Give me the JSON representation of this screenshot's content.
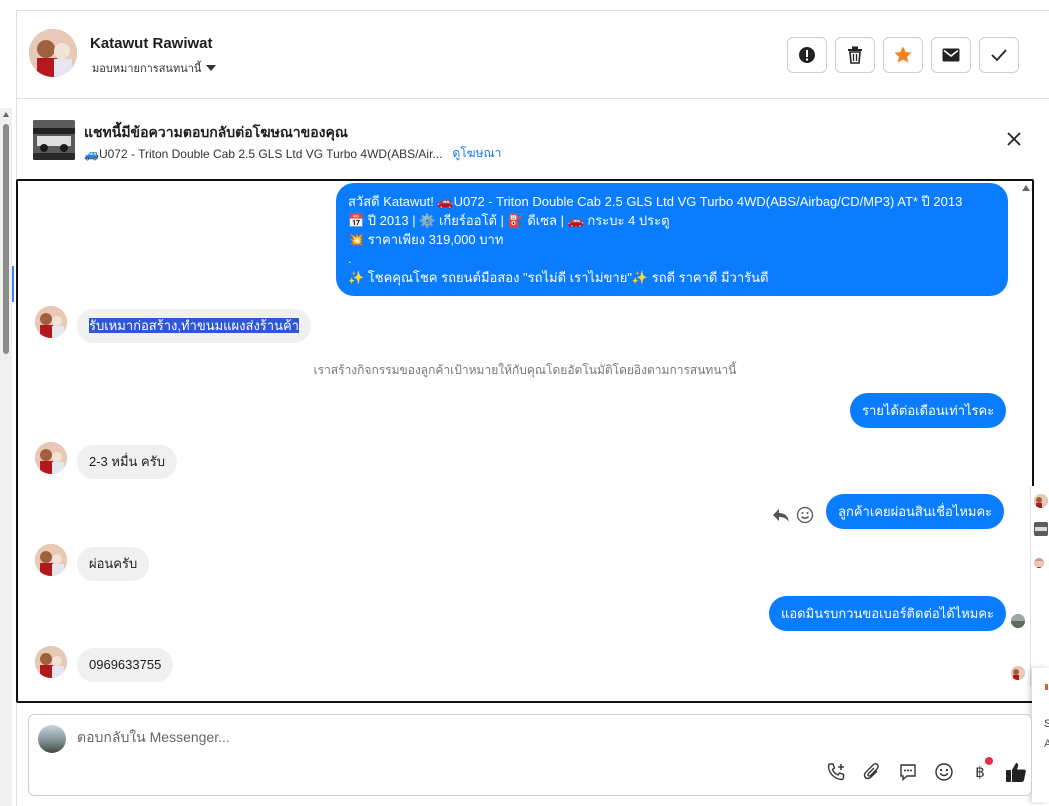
{
  "header": {
    "name": "Katawut Rawiwat",
    "assign_label": "มอบหมายการสนทนานี้",
    "actions": [
      "report-icon",
      "trash-icon",
      "star-icon",
      "mail-icon",
      "check-icon"
    ]
  },
  "ad": {
    "title": "แชทนี้มีข้อความตอบกลับต่อโฆษณาของคุณ",
    "product": "🚙U072 - Triton Double Cab 2.5 GLS Ltd VG Turbo 4WD(ABS/Air...",
    "view_link": "ดูโฆษณา"
  },
  "messages": {
    "m1_line1": "สวัสดี Katawut! 🚗U072 - Triton Double Cab 2.5 GLS Ltd VG Turbo 4WD(ABS/Airbag/CD/MP3) AT* ปี 2013",
    "m1_line2": "📅 ปี 2013 | ⚙️ เกียร์ออโต้ | ⛽ ดีเซล | 🚗 กระบะ 4 ประตู",
    "m1_line3": "💥 ราคาเพียง 319,000 บาท",
    "m1_line4": ".",
    "m1_line5": "✨ โชคคุณโชค รถยนต์มือสอง \"รถไม่ดี เราไม่ขาย\"✨ รถดี ราคาดี มีวารันตี",
    "m2": "รับเหมาก่อสร้าง,ทำขนมแผงส่งร้านค้า",
    "system_note": "เราสร้างกิจกรรมของลูกค้าเป้าหมายให้กับคุณโดยอัตโนมัติโดยอิงตามการสนทนานี้",
    "m3": "รายได้ต่อเดือนเท่าไรคะ",
    "m4": "2-3 หมื่น ครับ",
    "m5": "ลูกค้าเคยผ่อนสินเชื่อไหมคะ",
    "m6": "ผ่อนครับ",
    "m7": "แอดมินรบกวนขอเบอร์ติดต่อได้ไหมคะ",
    "m8": "0969633755"
  },
  "composer": {
    "placeholder": "ตอบกลับใน Messenger...",
    "tools": [
      "call-icon",
      "attach-icon",
      "saved-reply-icon",
      "emoji-icon",
      "baht-payment-icon",
      "like-icon"
    ],
    "baht_symbol": "฿"
  },
  "right_panel": {
    "text1": "S",
    "text2": "A"
  },
  "colors": {
    "outgoing_bubble": "#0a7cff",
    "incoming_bubble": "#f0f0f0",
    "star": "#f5821f",
    "link": "#1877f2"
  }
}
